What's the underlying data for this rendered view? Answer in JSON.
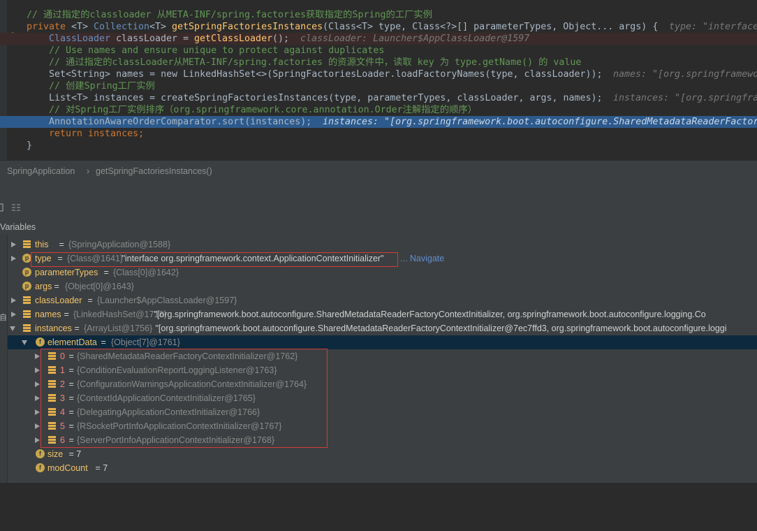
{
  "code": {
    "lines": [
      {
        "comment": "// 通过指定的classloader 从META-INF/spring.factories获取指定的Spring的工厂实例"
      },
      {
        "kw": "private",
        "typeParam": "<T>",
        "retType": "Collection",
        "ret2": "<T>",
        "method": "getSpringFactoriesInstances",
        "params": "(Class<T> type, Class<?>[] parameterTypes, Object... args) {",
        "hint": "type: \"interface"
      },
      {
        "type": "ClassLoader",
        "text": " classLoader = ",
        "call": "getClassLoader",
        "tail": "();",
        "hint": "classLoader: Launcher$AppClassLoader@1597"
      },
      {
        "comment": "// Use names and ensure unique to protect against duplicates"
      },
      {
        "comment": "// 通过指定的classLoader从META-INF/spring.factories 的资源文件中，读取 key 为 type.getName() 的 value"
      },
      {
        "code": "Set<String> names = new LinkedHashSet<>(SpringFactoriesLoader.loadFactoryNames(type, classLoader));",
        "hint": "names: \"[org.springframewo"
      },
      {
        "comment": "// 创建Spring工厂实例"
      },
      {
        "code": "List<T> instances = createSpringFactoriesInstances(type, parameterTypes, classLoader, args, names);",
        "hint": "instances: \"[org.springfra"
      },
      {
        "comment": "// 对Spring工厂实例排序（org.springframework.core.annotation.Order注解指定的顺序）"
      },
      {
        "code": "AnnotationAwareOrderComparator.sort(instances);",
        "hint": "instances: \"[org.springframework.boot.autoconfigure.SharedMetadataReaderFactor"
      },
      {
        "code": "return instances;"
      },
      {
        "code": "}"
      }
    ]
  },
  "breadcrumb": {
    "class": "SpringApplication",
    "sep": "›",
    "method": "getSpringFactoriesInstances()"
  },
  "panel": {
    "title": "Variables"
  },
  "vars": [
    {
      "name": "this",
      "eq": " = ",
      "ref": "{SpringApplication@1588}",
      "val": ""
    },
    {
      "name": "type",
      "eq": " = ",
      "ref": "{Class@1641}",
      "val": " \"interface org.springframework.context.ApplicationContextInitializer\"",
      "nav": "... Navigate"
    },
    {
      "name": "parameterTypes",
      "eq": " = ",
      "ref": "{Class[0]@1642}",
      "val": ""
    },
    {
      "name": "args",
      "eq": " = ",
      "ref": "{Object[0]@1643}",
      "val": ""
    },
    {
      "name": "classLoader",
      "eq": " = ",
      "ref": "{Launcher$AppClassLoader@1597}",
      "val": ""
    },
    {
      "name": "names",
      "eq": " = ",
      "ref": "{LinkedHashSet@1718}",
      "val": " \"[org.springframework.boot.autoconfigure.SharedMetadataReaderFactoryContextInitializer, org.springframework.boot.autoconfigure.logging.Co"
    },
    {
      "name": "instances",
      "eq": " = ",
      "ref": "{ArrayList@1756}",
      "val": " \"[org.springframework.boot.autoconfigure.SharedMetadataReaderFactoryContextInitializer@7ec7ffd3, org.springframework.boot.autoconfigure.loggi"
    },
    {
      "name": "elementData",
      "eq": " = ",
      "ref": "{Object[7]@1761}",
      "val": ""
    }
  ],
  "elements": [
    {
      "idx": "0",
      "eq": " = ",
      "ref": "{SharedMetadataReaderFactoryContextInitializer@1762}"
    },
    {
      "idx": "1",
      "eq": " = ",
      "ref": "{ConditionEvaluationReportLoggingListener@1763}"
    },
    {
      "idx": "2",
      "eq": " = ",
      "ref": "{ConfigurationWarningsApplicationContextInitializer@1764}"
    },
    {
      "idx": "3",
      "eq": " = ",
      "ref": "{ContextIdApplicationContextInitializer@1765}"
    },
    {
      "idx": "4",
      "eq": " = ",
      "ref": "{DelegatingApplicationContextInitializer@1766}"
    },
    {
      "idx": "5",
      "eq": " = ",
      "ref": "{RSocketPortInfoApplicationContextInitializer@1767}"
    },
    {
      "idx": "6",
      "eq": " = ",
      "ref": "{ServerPortInfoApplicationContextInitializer@1768}"
    }
  ],
  "size": {
    "name": "size",
    "val": " = 7"
  },
  "modCount": {
    "name": "modCount",
    "val": " = 7"
  },
  "strip": {
    "glyph": "自"
  }
}
